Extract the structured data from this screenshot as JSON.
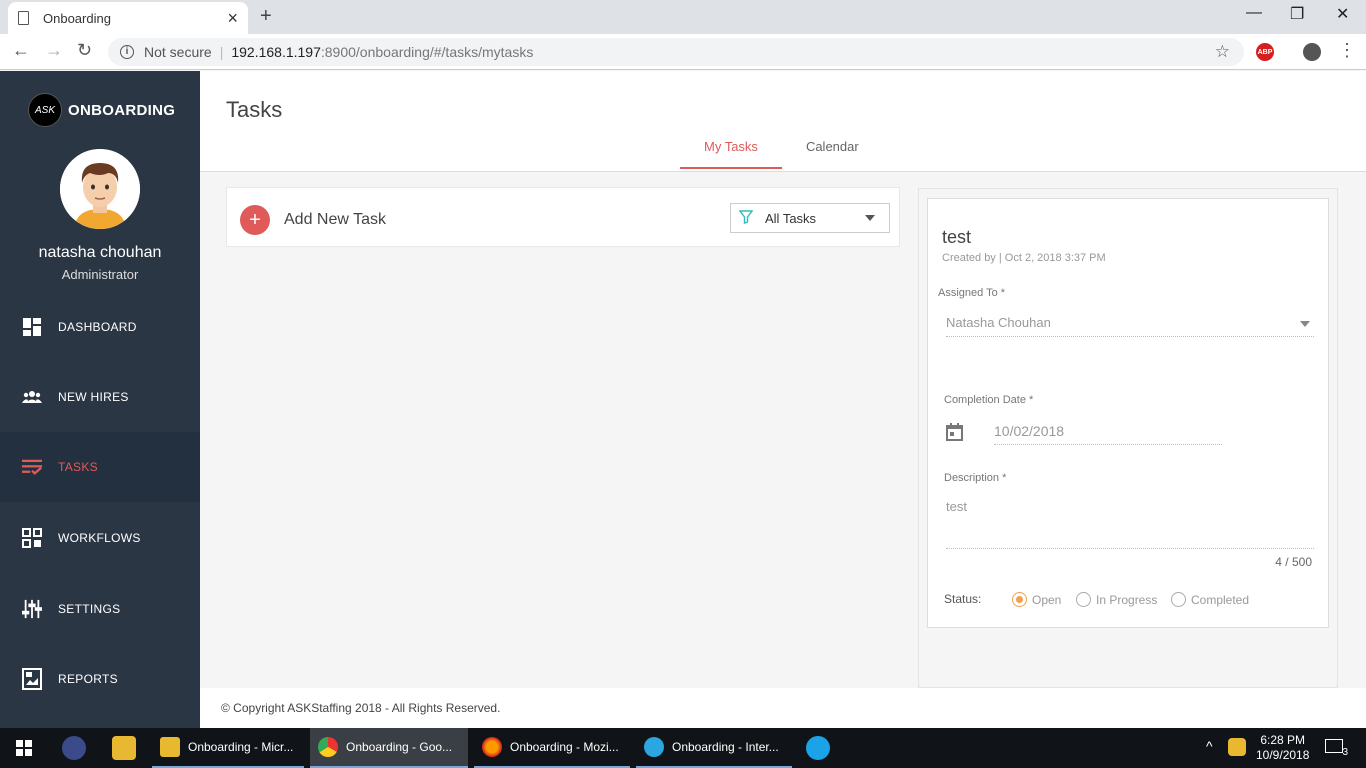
{
  "browser": {
    "tab_title": "Onboarding",
    "new_tab": "+",
    "not_secure": "Not secure",
    "url_host": "192.168.1.197",
    "url_path": ":8900/onboarding/#/tasks/mytasks",
    "abp": "ABP"
  },
  "sidebar": {
    "brand_logo": "ASK",
    "brand_name": "ONBOARDING",
    "user_name": "natasha chouhan",
    "user_role": "Administrator",
    "items": [
      {
        "label": "DASHBOARD",
        "icon": "dashboard-icon"
      },
      {
        "label": "NEW HIRES",
        "icon": "users-icon"
      },
      {
        "label": "TASKS",
        "icon": "tasks-icon",
        "active": true
      },
      {
        "label": "WORKFLOWS",
        "icon": "workflow-icon"
      },
      {
        "label": "SETTINGS",
        "icon": "sliders-icon"
      },
      {
        "label": "REPORTS",
        "icon": "report-icon"
      }
    ]
  },
  "main": {
    "page_title": "Tasks",
    "tabs": [
      {
        "label": "My Tasks",
        "active": true
      },
      {
        "label": "Calendar"
      }
    ],
    "add_task_label": "Add New Task",
    "filter_value": "All Tasks"
  },
  "detail": {
    "title": "test",
    "meta": "Created by | Oct 2, 2018 3:37 PM",
    "assigned_label": "Assigned To *",
    "assigned_value": "Natasha Chouhan",
    "completion_label": "Completion Date *",
    "completion_value": "10/02/2018",
    "description_label": "Description *",
    "description_value": "test",
    "counter": "4 / 500",
    "status_label": "Status:",
    "status_options": [
      "Open",
      "In Progress",
      "Completed"
    ],
    "status_selected": "Open"
  },
  "footer": {
    "copyright": "© Copyright ASKStaffing 2018 - All Rights Reserved."
  },
  "taskbar": {
    "apps": [
      {
        "label": "Onboarding - Micr..."
      },
      {
        "label": "Onboarding - Goo..."
      },
      {
        "label": "Onboarding - Mozi..."
      },
      {
        "label": "Onboarding - Inter..."
      }
    ],
    "time": "6:28 PM",
    "date": "10/9/2018",
    "notif_count": "3"
  },
  "colors": {
    "accent": "#e05a5a",
    "sidebar_bg": "#2b3645",
    "radio_selected": "#f0a050"
  }
}
